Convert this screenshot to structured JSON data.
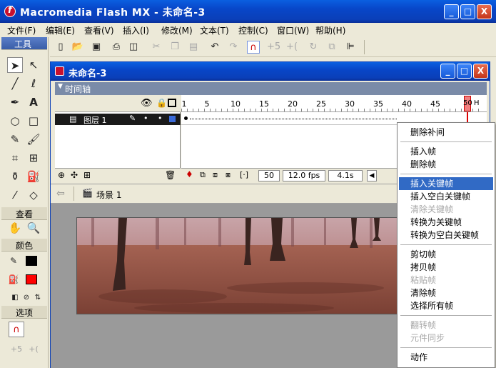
{
  "app": {
    "title": "Macromedia Flash MX - 未命名-3",
    "min": "_",
    "max": "□",
    "close": "X"
  },
  "menu": [
    "文件(F)",
    "编辑(E)",
    "查看(V)",
    "插入(I)",
    "修改(M)",
    "文本(T)",
    "控制(C)",
    "窗口(W)",
    "帮助(H)"
  ],
  "tools_panel": {
    "title": "工具",
    "view_label": "查看",
    "color_label": "颜色",
    "options_label": "选项",
    "stroke_color": "#000000",
    "fill_color": "#ff0000"
  },
  "document": {
    "title": "未命名-3",
    "timeline_label": "时间轴",
    "layer_name": "图层 1",
    "frame_numbers": [
      "1",
      "5",
      "10",
      "15",
      "20",
      "25",
      "30",
      "35",
      "40",
      "45",
      "50"
    ],
    "current_frame": "50",
    "frame_rate": "12.0 fps",
    "elapsed": "4.1s",
    "scene_name": "场景 1",
    "ruler_end": "H"
  },
  "context_menu": {
    "items": [
      {
        "label": "删除补间",
        "disabled": false,
        "highlighted": false
      },
      {
        "label": "插入帧",
        "disabled": false,
        "highlighted": false
      },
      {
        "label": "删除帧",
        "disabled": false,
        "highlighted": false
      },
      {
        "label": "插入关键帧",
        "disabled": false,
        "highlighted": true
      },
      {
        "label": "插入空白关键帧",
        "disabled": false,
        "highlighted": false
      },
      {
        "label": "清除关键帧",
        "disabled": true,
        "highlighted": false
      },
      {
        "label": "转换为关键帧",
        "disabled": false,
        "highlighted": false
      },
      {
        "label": "转换为空白关键帧",
        "disabled": false,
        "highlighted": false
      },
      {
        "label": "剪切帧",
        "disabled": false,
        "highlighted": false
      },
      {
        "label": "拷贝帧",
        "disabled": false,
        "highlighted": false
      },
      {
        "label": "粘贴帧",
        "disabled": true,
        "highlighted": false
      },
      {
        "label": "清除帧",
        "disabled": false,
        "highlighted": false
      },
      {
        "label": "选择所有帧",
        "disabled": false,
        "highlighted": false
      },
      {
        "label": "翻转帧",
        "disabled": true,
        "highlighted": false
      },
      {
        "label": "元件同步",
        "disabled": true,
        "highlighted": false
      },
      {
        "label": "动作",
        "disabled": false,
        "highlighted": false
      }
    ]
  }
}
